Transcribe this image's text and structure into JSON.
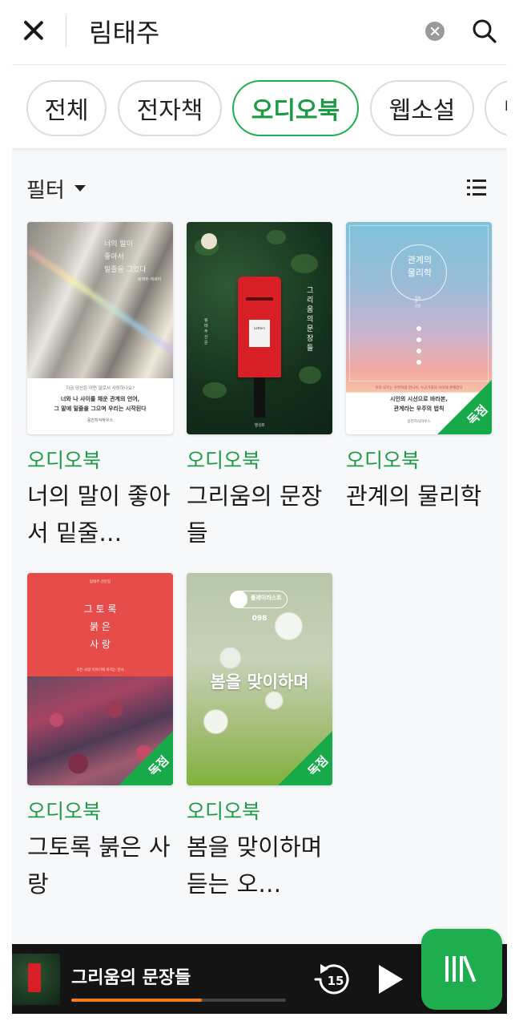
{
  "search": {
    "query": "림태주",
    "close_icon": "close-icon",
    "clear_icon": "clear-circle-icon",
    "search_icon": "search-icon"
  },
  "tabs": [
    {
      "label": "전체",
      "active": false
    },
    {
      "label": "전자책",
      "active": false
    },
    {
      "label": "오디오북",
      "active": true
    },
    {
      "label": "웹소설",
      "active": false
    },
    {
      "label": "만",
      "active": false
    }
  ],
  "filter": {
    "label": "필터",
    "caret_icon": "caret-down-icon",
    "view_icon": "list-view-icon"
  },
  "books": [
    {
      "type": "오디오북",
      "title": "너의 말이 좋아서 밑줄…",
      "exclusive": false,
      "cover": {
        "lines": [
          "너의 말이",
          "좋아서",
          "밑줄을 그었다"
        ],
        "author": "림태주 에세이",
        "subtitle": "지금 당신은 어떤 말로서 사랑하나요?",
        "tagline_1": "너와 나 사이를 채운 관계의 언어,",
        "tagline_2": "그 말에 밑줄을 그으며 우리는 시작된다",
        "publisher": "웅진지식하우스"
      }
    },
    {
      "type": "오디오북",
      "title": "그리움의 문장들",
      "exclusive": false,
      "cover": {
        "title_vertical": "그리움의 문장들",
        "author": "림태주 산문",
        "publisher": "행성B",
        "plate": "Letters"
      }
    },
    {
      "type": "오디오북",
      "title": "관계의 물리학",
      "exclusive": true,
      "cover": {
        "title_1": "관계의",
        "title_2": "물리학",
        "author": "림태주 산문",
        "tagline_top": "우리 모두는 우연처럼 만나서, 누군가와의 사이에 존재한다",
        "tagline_1": "시인의 시선으로 바라본,",
        "tagline_2": "관계라는 우주의 법칙",
        "publisher": "웅진지식하우스"
      }
    },
    {
      "type": "오디오북",
      "title": "그토록 붉은 사랑",
      "exclusive": true,
      "cover": {
        "top": "림태주 산문집",
        "title_lines": [
          "그 토 록",
          "붉 은",
          "사 랑"
        ],
        "tagline": "모든 사랑 이야기에 바치는 헌사"
      }
    },
    {
      "type": "오디오북",
      "title": "봄을 맞이하며 듣는 오…",
      "exclusive": true,
      "cover": {
        "logo": "플레이리스트",
        "number": "098",
        "title": "봄을 맞이하며"
      }
    }
  ],
  "badge_label": "독점",
  "player": {
    "title": "그리움의 문장들",
    "progress": 0.61,
    "rewind_label": "15",
    "rewind_icon": "rewind-15-icon",
    "play_icon": "play-icon"
  },
  "fab": {
    "icon": "library-icon"
  },
  "colors": {
    "accent": "#1fae4f",
    "accent_text": "#1c9a45",
    "progress": "#f07b1d",
    "player_bg": "#141414"
  }
}
